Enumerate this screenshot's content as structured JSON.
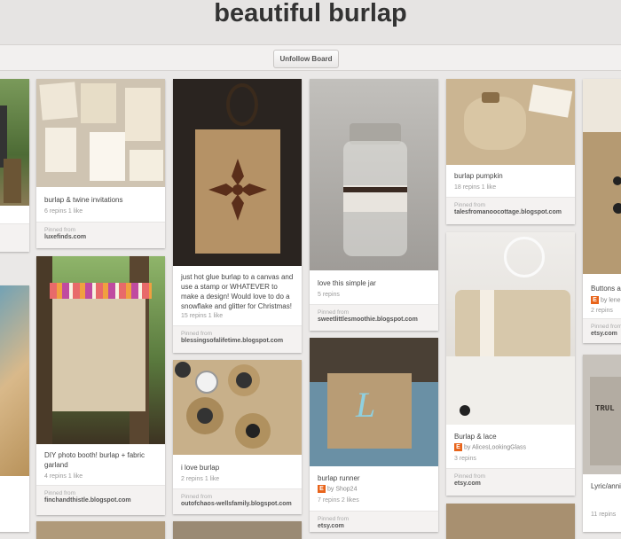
{
  "board": {
    "title": "beautiful burlap",
    "unfollow_label": "Unfollow Board"
  },
  "common": {
    "pinned_from": "Pinned from"
  },
  "pins": {
    "invites": {
      "desc": "burlap & twine invitations",
      "stats": "6 repins   1 like",
      "source": "luxefinds.com"
    },
    "canvas": {
      "desc": "just hot glue burlap to a canvas and use a stamp or WHATEVER to make a design! Would love to do a snowflake and glitter for Christmas!",
      "stats": "15 repins   1 like",
      "source": "blessingsofalifetime.blogspot.com"
    },
    "jar": {
      "desc": "love this simple jar",
      "stats": "5 repins",
      "source": "sweetlittlesmoothie.blogspot.com"
    },
    "pumpkin": {
      "desc": "burlap pumpkin",
      "stats": "18 repins   1 like",
      "source": "talesfromanoocottage.blogspot.com"
    },
    "buttons": {
      "desc": "Buttons a",
      "by": "by lene",
      "stats": "2 repins",
      "source": "etsy.com"
    },
    "booth": {
      "desc": "DIY photo booth! burlap + fabric garland",
      "stats": "4 repins   1 like",
      "source": "finchandthistle.blogspot.com"
    },
    "flowers": {
      "desc": "i love burlap",
      "stats": "2 repins   1 like",
      "source": "outofchaos-wellsfamily.blogspot.com"
    },
    "runner": {
      "desc": "burlap runner",
      "by": "by Shop24",
      "stats": "7 repins   2 likes",
      "source": "etsy.com"
    },
    "lace": {
      "desc": "Burlap & lace",
      "by": "by AlicesLookingGlass",
      "stats": "3 repins",
      "source": "etsy.com"
    },
    "lyric": {
      "desc": "Lyric/anni",
      "stats": "11 repins",
      "pillow_text": "TRUL"
    }
  },
  "colors": {
    "accent": "#e8641b",
    "background": "#eae8e7"
  }
}
